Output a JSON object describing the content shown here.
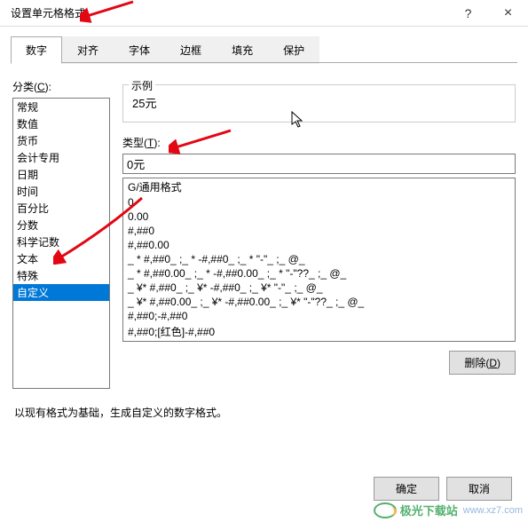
{
  "window": {
    "title": "设置单元格格式",
    "help": "?",
    "close": "×"
  },
  "tabs": {
    "items": [
      {
        "label": "数字"
      },
      {
        "label": "对齐"
      },
      {
        "label": "字体"
      },
      {
        "label": "边框"
      },
      {
        "label": "填充"
      },
      {
        "label": "保护"
      }
    ],
    "active_index": 0
  },
  "category": {
    "label_prefix": "分类(",
    "label_key": "C",
    "label_suffix": "):",
    "items": [
      "常规",
      "数值",
      "货币",
      "会计专用",
      "日期",
      "时间",
      "百分比",
      "分数",
      "科学记数",
      "文本",
      "特殊",
      "自定义"
    ],
    "selected_index": 11
  },
  "example": {
    "group_label": "示例",
    "value": "25元"
  },
  "type": {
    "label_prefix": "类型(",
    "label_key": "T",
    "label_suffix": "):",
    "input_value": "0元",
    "items": [
      "G/通用格式",
      "0",
      "0.00",
      "#,##0",
      "#,##0.00",
      "_ * #,##0_ ;_ * -#,##0_ ;_ * \"-\"_ ;_ @_ ",
      "_ * #,##0.00_ ;_ * -#,##0.00_ ;_ * \"-\"??_ ;_ @_ ",
      "_ ¥* #,##0_ ;_ ¥* -#,##0_ ;_ ¥* \"-\"_ ;_ @_ ",
      "_ ¥* #,##0.00_ ;_ ¥* -#,##0.00_ ;_ ¥* \"-\"??_ ;_ @_ ",
      "#,##0;-#,##0",
      "#,##0;[红色]-#,##0"
    ]
  },
  "buttons": {
    "delete_prefix": "删除(",
    "delete_key": "D",
    "delete_suffix": ")",
    "ok": "确定",
    "cancel": "取消"
  },
  "hint": "以现有格式为基础，生成自定义的数字格式。",
  "watermark": {
    "name": "极光下载站",
    "url": "www.xz7.com"
  },
  "annotations": {
    "arrow_color": "#e30613"
  }
}
